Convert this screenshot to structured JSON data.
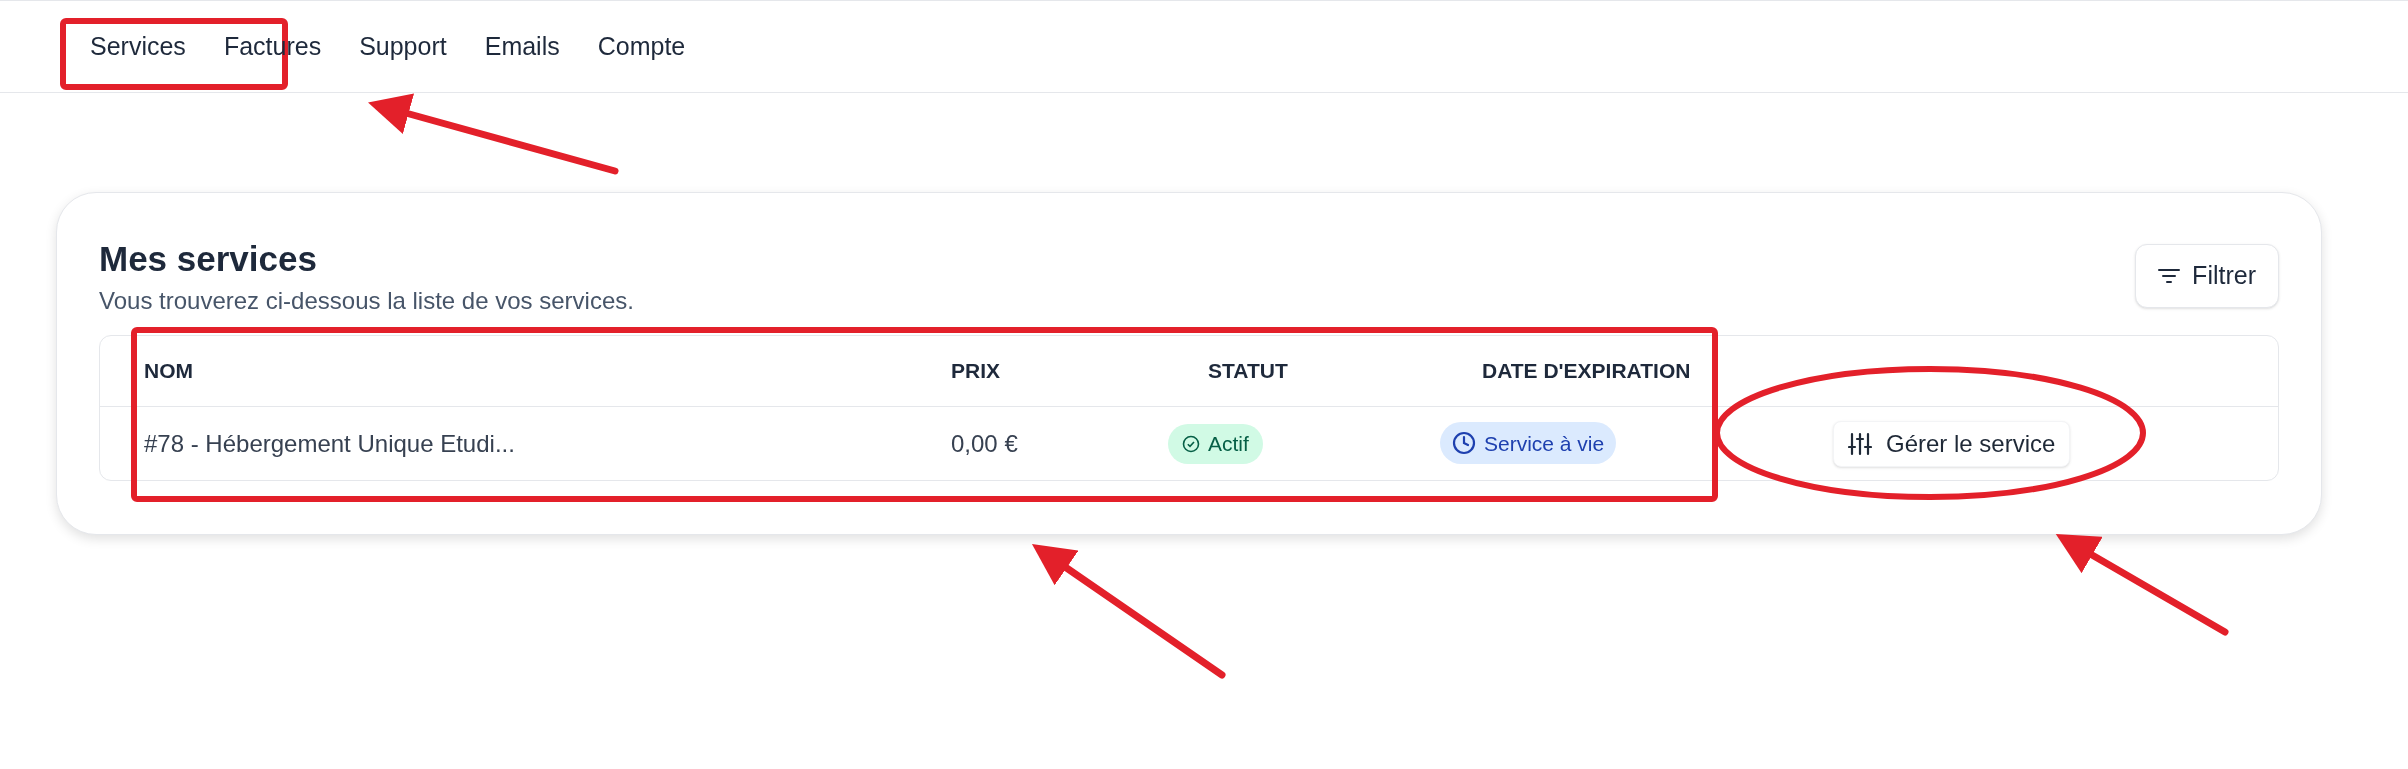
{
  "nav": [
    {
      "label": "Services"
    },
    {
      "label": "Factures"
    },
    {
      "label": "Support"
    },
    {
      "label": "Emails"
    },
    {
      "label": "Compte"
    }
  ],
  "card": {
    "title": "Mes services",
    "subtitle": "Vous trouverez ci-dessous la liste de vos services.",
    "filter_button": "Filtrer"
  },
  "table": {
    "columns": [
      "NOM",
      "PRIX",
      "STATUT",
      "DATE D'EXPIRATION"
    ],
    "rows": [
      {
        "name": "#78 - Hébergement Unique Etudi...",
        "price": "0,00 €",
        "status": "Actif",
        "expiration": "Service à vie",
        "action": "Gérer le service"
      }
    ]
  }
}
